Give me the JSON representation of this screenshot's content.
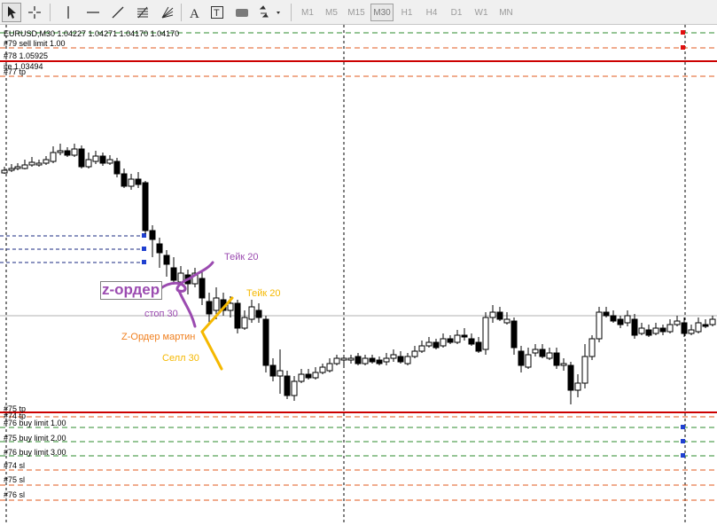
{
  "toolbar": {
    "tools": [
      {
        "name": "cursor-icon"
      },
      {
        "name": "crosshair-icon"
      },
      {
        "name": "vertical-line-icon"
      },
      {
        "name": "horizontal-line-icon"
      },
      {
        "name": "trendline-icon"
      },
      {
        "name": "fibonacci-icon"
      },
      {
        "name": "fibonacci-fan-icon"
      },
      {
        "name": "text-icon"
      },
      {
        "name": "text-label-icon"
      },
      {
        "name": "rectangle-icon"
      },
      {
        "name": "shapes-dropdown-icon"
      }
    ],
    "timeframes": [
      "M1",
      "M5",
      "M15",
      "M30",
      "H1",
      "H4",
      "D1",
      "W1",
      "MN"
    ],
    "active_timeframe": "M30"
  },
  "chart": {
    "info_line": "EURUSD,M30  1.04227 1.04271 1.04170 1.04170",
    "colors": {
      "background": "#ffffff",
      "tp_line": "#e05a1c",
      "limit_line": "#2e8b2e",
      "price_line": "#cc0000",
      "grid": "#000000",
      "purple_note": "#9b4bb0",
      "orange_note": "#f0a020",
      "yellow_note": "#f5b800"
    },
    "order_labels": [
      {
        "text": "#79 sell limit 1.00"
      },
      {
        "text": "#78 1.05925"
      },
      {
        "text": "ite 1.03494"
      },
      {
        "text": "#77 tp"
      },
      {
        "text": "#75 tp"
      },
      {
        "text": "#74 tp"
      },
      {
        "text": "#76 buy limit 1.00"
      },
      {
        "text": "#75 buy limit 2.00"
      },
      {
        "text": "#76 buy limit 3.00"
      },
      {
        "text": "#74 sl"
      },
      {
        "text": "#75 sl"
      },
      {
        "text": "#76 sl"
      }
    ],
    "annotations": {
      "take_purple": "Тейк 20",
      "z_order": "z-ордер",
      "stop": "стоп 30",
      "take_yellow": "Тейк 20",
      "z_martin": "Z-Ордер мартин",
      "sell": "Селл 30"
    }
  }
}
